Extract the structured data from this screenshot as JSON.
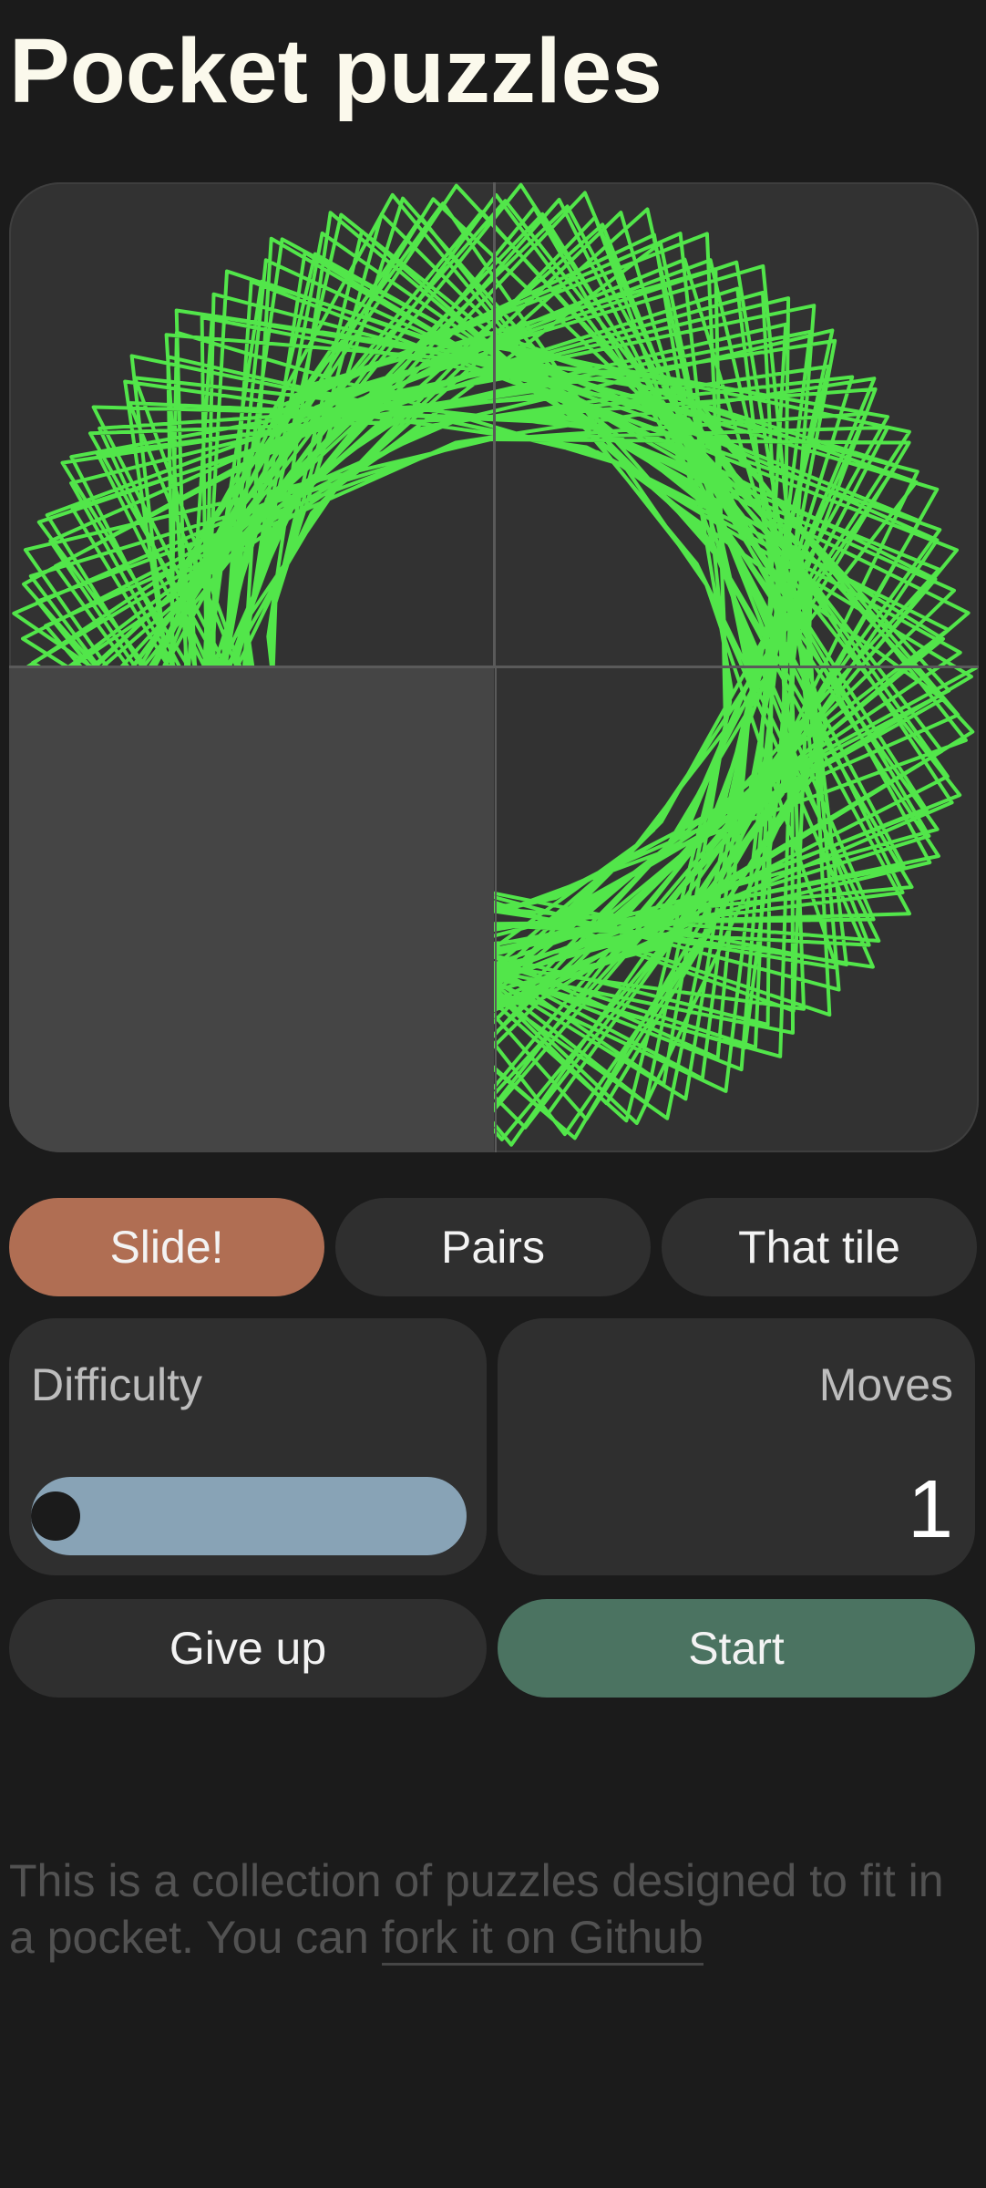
{
  "header": {
    "title": "Pocket puzzles"
  },
  "board": {
    "stroke_color": "#52e64a",
    "tile_color": "#323232",
    "empty_tile_color": "#454545"
  },
  "tabs": [
    {
      "label": "Slide!",
      "active": true
    },
    {
      "label": "Pairs",
      "active": false
    },
    {
      "label": "That tile",
      "active": false
    }
  ],
  "difficulty": {
    "label": "Difficulty",
    "level": 0,
    "track_color": "#88a3b6"
  },
  "moves": {
    "label": "Moves",
    "value": "1"
  },
  "actions": {
    "give_up_label": "Give up",
    "start_label": "Start",
    "give_up_color": "#2f2f2f",
    "start_color": "#4b7361"
  },
  "footer": {
    "text": "This is a collection of puzzles designed to fit in a pocket. You can ",
    "link_label": "fork it on Github"
  }
}
